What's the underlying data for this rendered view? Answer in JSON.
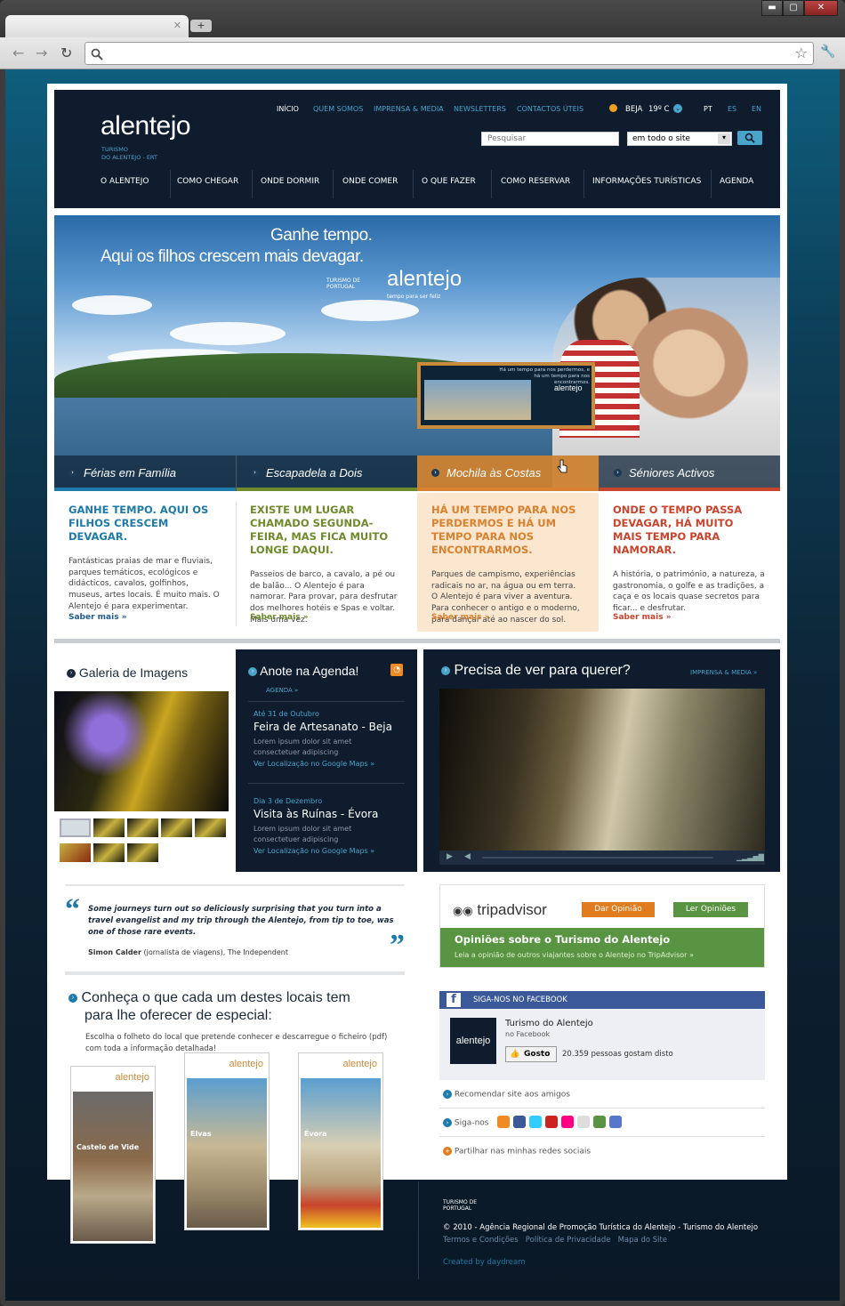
{
  "browser": {
    "back": "←",
    "forward": "→",
    "reload": "↻",
    "newtab": "+",
    "min": "▬",
    "max": "▢",
    "close": "✕",
    "star": "☆",
    "wrench": "🔧"
  },
  "site": {
    "logo": "alentejo",
    "logo_sub1": "TURISMO",
    "logo_sub2": "DO ALENTEJO - ERT",
    "toplinks": [
      "INÍCIO",
      "QUEM SOMOS",
      "IMPRENSA & MEDIA",
      "NEWSLETTERS",
      "CONTACTOS ÚTEIS"
    ],
    "weather_city": "BEJA",
    "weather_temp": "19º C",
    "langs": [
      "PT",
      "ES",
      "EN"
    ],
    "search_placeholder": "Pesquisar",
    "search_scope": "em todo o site",
    "nav": [
      "O ALENTEJO",
      "COMO CHEGAR",
      "ONDE DORMIR",
      "ONDE COMER",
      "O QUE FAZER",
      "COMO RESERVAR",
      "INFORMAÇÕES TURÍSTICAS",
      "AGENDA"
    ]
  },
  "hero": {
    "title1": "Ganhe tempo.",
    "title2": "Aqui os filhos crescem mais devagar.",
    "brand": "alentejo",
    "brand_tag": "tempo para ser feliz",
    "tp": "TURISMO DE PORTUGAL",
    "mini_text": "Há um tempo para nos perdermos, e há um tempo para nos encontrarmos.",
    "mini_brand": "alentejo",
    "cats": [
      "Férias em Família",
      "Escapadela a Dois",
      "Mochila às Costas",
      "Séniores Activos"
    ]
  },
  "features": [
    {
      "title": "GANHE TEMPO. AQUI OS FILHOS CRESCEM DEVAGAR.",
      "text": "Fantásticas praias de mar e fluviais, parques temáticos, ecológicos e didácticos, cavalos, golfinhos, museus, artes locais. É muito mais. O Alentejo é para experimentar.",
      "more": "Saber mais »",
      "color": "#1e7aa8"
    },
    {
      "title": "EXISTE UM LUGAR CHAMADO SEGUNDA-FEIRA, MAS FICA MUITO LONGE DAQUI.",
      "text": "Passeios de barco, a cavalo, a pé ou de balão... O Alentejo é para namorar. Para provar, para desfrutar dos melhores hotéis e Spas e voltar. Mais uma vez.",
      "more": "Saber mais »",
      "color": "#6f8a2b"
    },
    {
      "title": "HÁ UM TEMPO PARA NOS PERDERMOS E HÁ UM TEMPO PARA NOS ENCONTRARMOS.",
      "text": "Parques de campismo, experiências radicais no ar, na água ou em terra. O Alentejo é para viver a aventura. Para conhecer o antigo e o moderno, para dançar até ao nascer do sol.",
      "more": "Saber mais »",
      "color": "#d9812e"
    },
    {
      "title": "ONDE O TEMPO PASSA DEVAGAR, HÁ MUITO MAIS TEMPO PARA NAMORAR.",
      "text": "A história, o património, a natureza, a gastronomia, o golfe e as tradições, a caça e os locais quase secretos para ficar... e desfrutar.",
      "more": "Saber mais »",
      "color": "#c8442c"
    }
  ],
  "gallery": {
    "title": "Galeria de Imagens"
  },
  "agenda": {
    "title": "Anote na Agenda!",
    "sublink": "AGENDA »",
    "events": [
      {
        "date": "Até 31 de Outubro",
        "name": "Feira de Artesanato - Beja",
        "desc": "Lorem ipsum dolor sit amet consectetuer adipiscing",
        "link": "Ver Localização no Google Maps »"
      },
      {
        "date": "Dia 3 de Dezembro",
        "name": "Visita às Ruínas - Évora",
        "desc": "Lorem ipsum dolor sit amet consectetuer adipiscing",
        "link": "Ver Localização no Google Maps »"
      }
    ]
  },
  "video": {
    "title": "Precisa de ver para querer?",
    "link": "IMPRENSA & MEDIA »"
  },
  "quote": {
    "text": "Some journeys turn out so deliciously surprising that you turn into a travel evangelist and my trip through the Alentejo, from tip to toe, was one of those rare events.",
    "author": "Simon Calder",
    "source": "(jornalista de viagens), The Independent"
  },
  "trip": {
    "logo": "tripadvisor",
    "btn1": "Dar Opinião",
    "btn2": "Ler Opiniões",
    "headline": "Opiniões sobre o Turismo do Alentejo",
    "sub": "Leia a opinião de outros viajantes sobre o Alentejo no TripAdvisor  »"
  },
  "fb": {
    "header": "SIGA-NOS NO FACEBOOK",
    "name": "Turismo do Alentejo",
    "on": "no Facebook",
    "like": "Gosto",
    "count": "20.359 pessoas gostam disto",
    "logo": "alentejo"
  },
  "links": {
    "recommend": "Recomendar site aos amigos",
    "follow": "Siga-nos",
    "share": "Partilhar nas minhas redes sociais"
  },
  "brochures": {
    "title1": "Conheça o que cada um destes locais tem",
    "title2": "para lhe oferecer de especial:",
    "desc": "Escolha o folheto do local que pretende conhecer e descarregue o ficheiro (pdf) com toda a informação detalhada!",
    "items": [
      {
        "name": "Castelo de Vide",
        "logo": "alentejo"
      },
      {
        "name": "Elvas",
        "logo": "alentejo"
      },
      {
        "name": "Évora",
        "logo": "alentejo"
      }
    ]
  },
  "footer": {
    "tp": "TURISMO DE PORTUGAL",
    "copy": "© 2010 - Agência Regional de Promoção Turística do Alentejo - Turismo do Alentejo",
    "links": [
      "Termos e Condições",
      "Política de Privacidade",
      "Mapa do Site"
    ],
    "credit": "Created by daydream"
  }
}
